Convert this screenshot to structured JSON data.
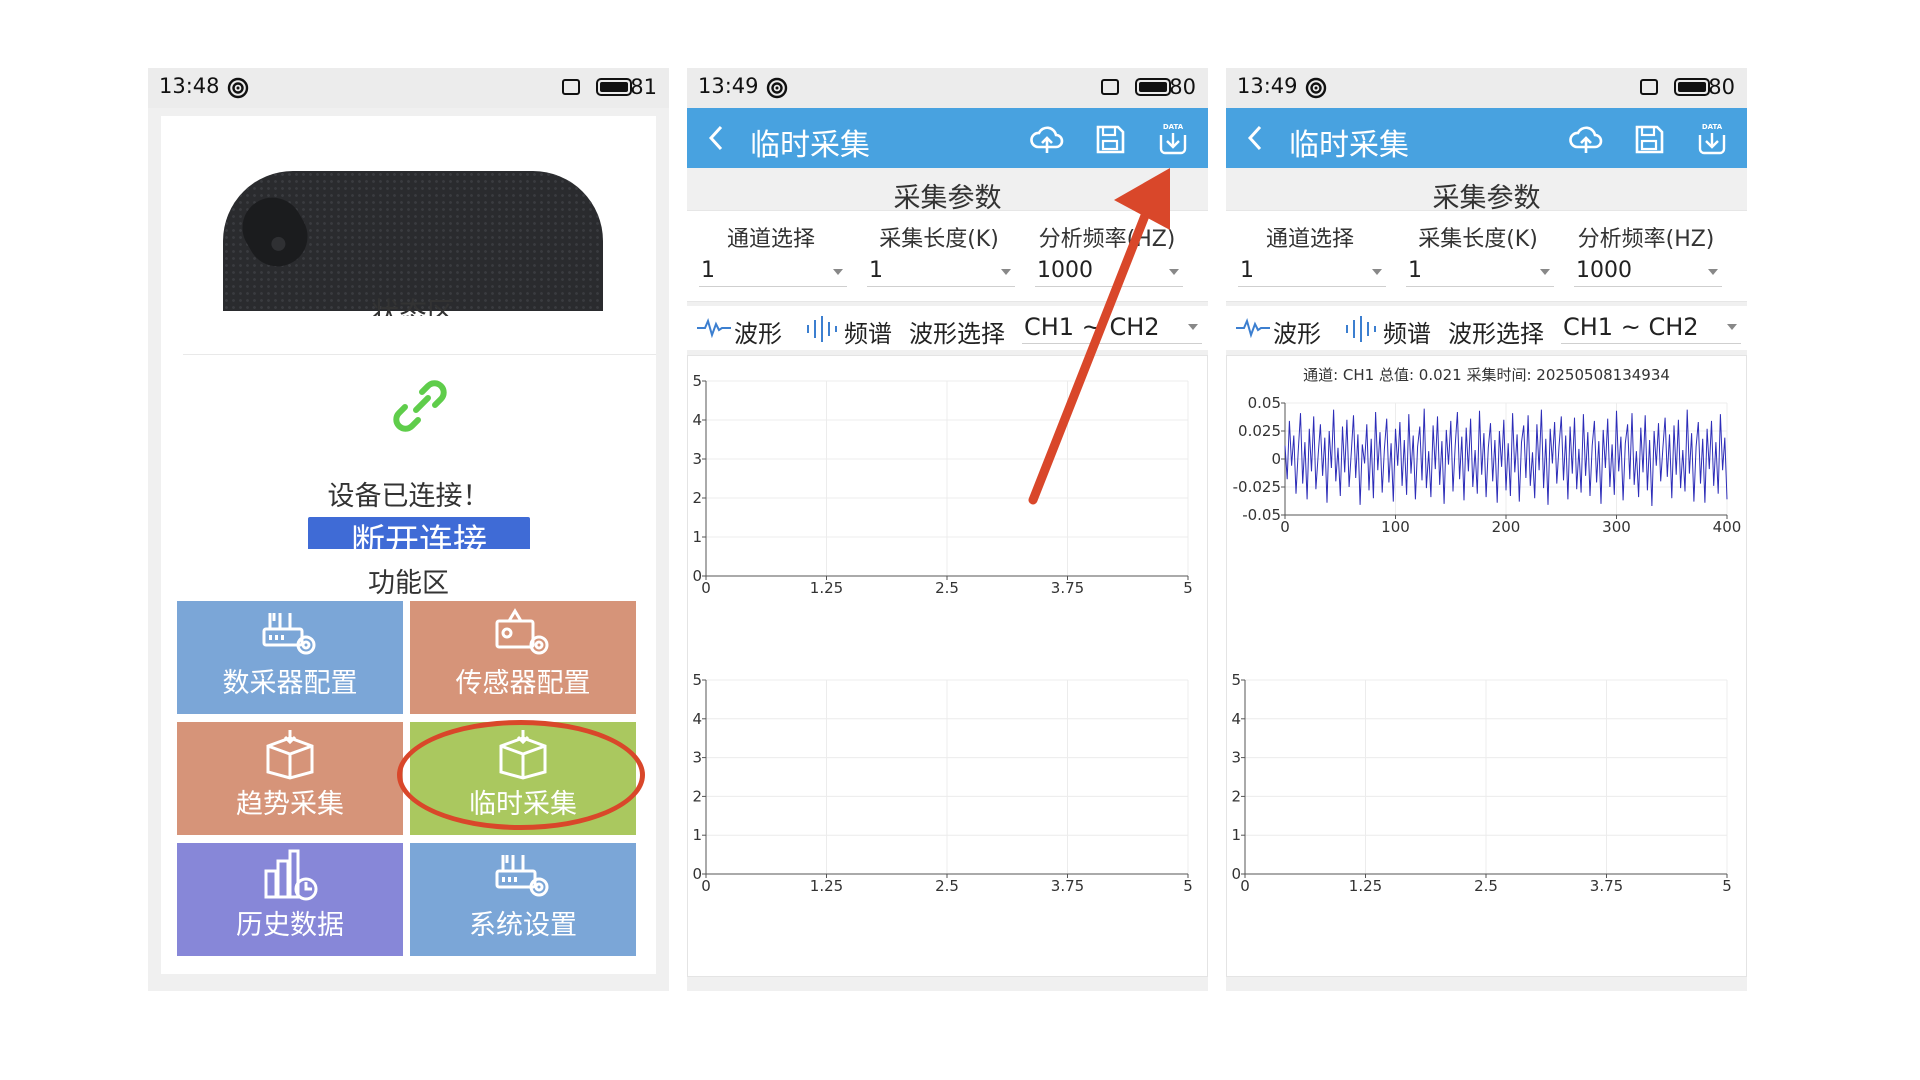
{
  "phone1": {
    "status": {
      "time": "13:48",
      "battery": "81"
    },
    "status_area_label": "状态区",
    "connected_text": "设备已连接！",
    "disconnect_label": "断开连接",
    "func_title": "功能区",
    "tiles": [
      {
        "label": "数采器配置",
        "icon": "router-gear-icon",
        "color": "#7ba6d7"
      },
      {
        "label": "传感器配置",
        "icon": "sensor-gear-icon",
        "color": "#d69479"
      },
      {
        "label": "趋势采集",
        "icon": "box-download-icon",
        "color": "#d69479"
      },
      {
        "label": "临时采集",
        "icon": "box-download-icon",
        "color": "#aac85f"
      },
      {
        "label": "历史数据",
        "icon": "chart-clock-icon",
        "color": "#8787d8"
      },
      {
        "label": "系统设置",
        "icon": "router-gear-icon",
        "color": "#7ba6d7"
      }
    ]
  },
  "phone2": {
    "status": {
      "time": "13:49",
      "battery": "80"
    },
    "title": "临时采集",
    "param_title": "采集参数",
    "params": [
      {
        "label": "通道选择",
        "value": "1"
      },
      {
        "label": "采集长度(K)",
        "value": "1"
      },
      {
        "label": "分析频率(HZ)",
        "value": "1000"
      }
    ],
    "wave_label": "波形",
    "spectrum_label": "频谱",
    "wave_select_label": "波形选择",
    "channel_value": "CH1 ~ CH2"
  },
  "phone3": {
    "status": {
      "time": "13:49",
      "battery": "80"
    },
    "title": "临时采集",
    "param_title": "采集参数",
    "params": [
      {
        "label": "通道选择",
        "value": "1"
      },
      {
        "label": "采集长度(K)",
        "value": "1"
      },
      {
        "label": "分析频率(HZ)",
        "value": "1000"
      }
    ],
    "wave_label": "波形",
    "spectrum_label": "频谱",
    "wave_select_label": "波形选择",
    "channel_value": "CH1 ~ CH2",
    "chart_header": "通道: CH1  总值: 0.021 采集时间: 20250508134934"
  },
  "annotation_colors": {
    "arrow": "#d9472a",
    "ellipse": "#d9472a"
  },
  "chart_data": [
    {
      "id": "p2-top",
      "type": "line",
      "x_ticks": [
        "0",
        "1.25",
        "2.5",
        "3.75",
        "5"
      ],
      "y_ticks": [
        "0",
        "1",
        "2",
        "3",
        "4",
        "5"
      ],
      "xlim": [
        0,
        5
      ],
      "ylim": [
        0,
        5
      ],
      "grid": true,
      "series": []
    },
    {
      "id": "p2-bottom",
      "type": "line",
      "x_ticks": [
        "0",
        "1.25",
        "2.5",
        "3.75",
        "5"
      ],
      "y_ticks": [
        "0",
        "1",
        "2",
        "3",
        "4",
        "5"
      ],
      "xlim": [
        0,
        5
      ],
      "ylim": [
        0,
        5
      ],
      "grid": true,
      "series": []
    },
    {
      "id": "p3-top",
      "type": "line",
      "x_ticks": [
        "0",
        "100",
        "200",
        "300",
        "400"
      ],
      "y_ticks": [
        "-0.05",
        "-0.025",
        "0",
        "0.025",
        "0.05"
      ],
      "xlim": [
        0,
        400
      ],
      "ylim": [
        -0.05,
        0.05
      ],
      "grid": true,
      "color": "#2d2db8",
      "series": [
        {
          "values": [
            0.012,
            -0.018,
            0.034,
            -0.006,
            0.021,
            -0.031,
            0.008,
            0.041,
            -0.022,
            0.015,
            -0.036,
            0.027,
            -0.011,
            0.038,
            -0.027,
            0.004,
            0.031,
            -0.015,
            0.019,
            -0.039,
            0.025,
            -0.008,
            0.044,
            -0.02,
            0.01,
            -0.033,
            0.029,
            -0.012,
            0.035,
            -0.025,
            0.006,
            0.039,
            -0.017,
            0.022,
            -0.041,
            0.013,
            -0.004,
            0.031,
            -0.028,
            0.018,
            -0.035,
            0.042,
            -0.01,
            0.024,
            -0.03,
            0.009,
            0.036,
            -0.021,
            0.014,
            -0.038,
            0.027,
            -0.006,
            0.033,
            -0.024,
            0.017,
            -0.032,
            0.04,
            -0.013,
            0.021,
            -0.036,
            0.011,
            0.029,
            -0.019,
            0.045,
            -0.026,
            0.007,
            -0.034,
            0.03,
            -0.009,
            0.038,
            -0.023,
            0.016,
            -0.04,
            0.026,
            -0.005,
            0.034,
            -0.029,
            0.012,
            0.042,
            -0.018,
            0.02,
            -0.037,
            0.028,
            -0.011,
            0.036,
            -0.025,
            0.008,
            -0.031,
            0.043,
            -0.014,
            0.023,
            -0.034,
            0.01,
            0.032,
            -0.02,
            0.017,
            -0.039,
            0.025,
            -0.007,
            0.035,
            -0.028,
            0.014,
            -0.033,
            0.041,
            -0.012,
            0.022,
            -0.038,
            0.015,
            0.03,
            -0.017,
            0.039,
            -0.024,
            0.006,
            -0.035,
            0.031,
            -0.01,
            0.044,
            -0.026,
            0.018,
            -0.041,
            0.027,
            -0.004,
            0.033,
            -0.022,
            0.011,
            0.038,
            -0.019,
            0.021,
            -0.036,
            0.029,
            -0.013,
            0.037,
            -0.027,
            0.009,
            -0.03,
            0.04,
            -0.015,
            0.024,
            -0.033,
            0.012,
            0.034,
            -0.021,
            0.016,
            -0.04,
            0.026,
            -0.008,
            0.036,
            -0.025,
            0.013,
            -0.032,
            0.043,
            -0.011,
            0.02,
            -0.037,
            0.014,
            0.031,
            -0.018,
            0.041,
            -0.023,
            0.007,
            -0.034,
            0.028,
            -0.012,
            0.039,
            -0.028,
            0.017,
            -0.042,
            0.025,
            -0.006,
            0.032,
            -0.02,
            0.01,
            0.037,
            -0.016,
            0.022,
            -0.035,
            0.03,
            -0.014,
            0.035,
            -0.026,
            0.008,
            -0.029,
            0.044,
            -0.013,
            0.023,
            -0.038,
            0.011,
            0.033,
            -0.022,
            0.018,
            -0.039,
            0.027,
            -0.009,
            0.034,
            -0.024,
            0.015,
            -0.031,
            0.04,
            -0.01,
            0.019,
            -0.036
          ]
        }
      ]
    },
    {
      "id": "p3-bottom",
      "type": "line",
      "x_ticks": [
        "0",
        "1.25",
        "2.5",
        "3.75",
        "5"
      ],
      "y_ticks": [
        "0",
        "1",
        "2",
        "3",
        "4",
        "5"
      ],
      "xlim": [
        0,
        5
      ],
      "ylim": [
        0,
        5
      ],
      "grid": true,
      "series": []
    }
  ]
}
